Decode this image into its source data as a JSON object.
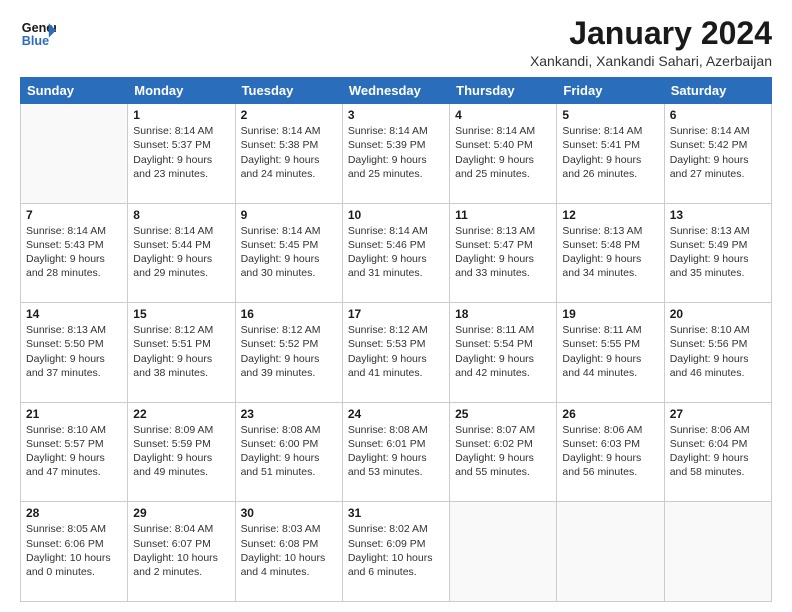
{
  "logo": {
    "line1": "General",
    "line2": "Blue"
  },
  "title": "January 2024",
  "subtitle": "Xankandi, Xankandi Sahari, Azerbaijan",
  "days_of_week": [
    "Sunday",
    "Monday",
    "Tuesday",
    "Wednesday",
    "Thursday",
    "Friday",
    "Saturday"
  ],
  "weeks": [
    [
      {
        "num": "",
        "sunrise": "",
        "sunset": "",
        "daylight": ""
      },
      {
        "num": "1",
        "sunrise": "Sunrise: 8:14 AM",
        "sunset": "Sunset: 5:37 PM",
        "daylight": "Daylight: 9 hours and 23 minutes."
      },
      {
        "num": "2",
        "sunrise": "Sunrise: 8:14 AM",
        "sunset": "Sunset: 5:38 PM",
        "daylight": "Daylight: 9 hours and 24 minutes."
      },
      {
        "num": "3",
        "sunrise": "Sunrise: 8:14 AM",
        "sunset": "Sunset: 5:39 PM",
        "daylight": "Daylight: 9 hours and 25 minutes."
      },
      {
        "num": "4",
        "sunrise": "Sunrise: 8:14 AM",
        "sunset": "Sunset: 5:40 PM",
        "daylight": "Daylight: 9 hours and 25 minutes."
      },
      {
        "num": "5",
        "sunrise": "Sunrise: 8:14 AM",
        "sunset": "Sunset: 5:41 PM",
        "daylight": "Daylight: 9 hours and 26 minutes."
      },
      {
        "num": "6",
        "sunrise": "Sunrise: 8:14 AM",
        "sunset": "Sunset: 5:42 PM",
        "daylight": "Daylight: 9 hours and 27 minutes."
      }
    ],
    [
      {
        "num": "7",
        "sunrise": "Sunrise: 8:14 AM",
        "sunset": "Sunset: 5:43 PM",
        "daylight": "Daylight: 9 hours and 28 minutes."
      },
      {
        "num": "8",
        "sunrise": "Sunrise: 8:14 AM",
        "sunset": "Sunset: 5:44 PM",
        "daylight": "Daylight: 9 hours and 29 minutes."
      },
      {
        "num": "9",
        "sunrise": "Sunrise: 8:14 AM",
        "sunset": "Sunset: 5:45 PM",
        "daylight": "Daylight: 9 hours and 30 minutes."
      },
      {
        "num": "10",
        "sunrise": "Sunrise: 8:14 AM",
        "sunset": "Sunset: 5:46 PM",
        "daylight": "Daylight: 9 hours and 31 minutes."
      },
      {
        "num": "11",
        "sunrise": "Sunrise: 8:13 AM",
        "sunset": "Sunset: 5:47 PM",
        "daylight": "Daylight: 9 hours and 33 minutes."
      },
      {
        "num": "12",
        "sunrise": "Sunrise: 8:13 AM",
        "sunset": "Sunset: 5:48 PM",
        "daylight": "Daylight: 9 hours and 34 minutes."
      },
      {
        "num": "13",
        "sunrise": "Sunrise: 8:13 AM",
        "sunset": "Sunset: 5:49 PM",
        "daylight": "Daylight: 9 hours and 35 minutes."
      }
    ],
    [
      {
        "num": "14",
        "sunrise": "Sunrise: 8:13 AM",
        "sunset": "Sunset: 5:50 PM",
        "daylight": "Daylight: 9 hours and 37 minutes."
      },
      {
        "num": "15",
        "sunrise": "Sunrise: 8:12 AM",
        "sunset": "Sunset: 5:51 PM",
        "daylight": "Daylight: 9 hours and 38 minutes."
      },
      {
        "num": "16",
        "sunrise": "Sunrise: 8:12 AM",
        "sunset": "Sunset: 5:52 PM",
        "daylight": "Daylight: 9 hours and 39 minutes."
      },
      {
        "num": "17",
        "sunrise": "Sunrise: 8:12 AM",
        "sunset": "Sunset: 5:53 PM",
        "daylight": "Daylight: 9 hours and 41 minutes."
      },
      {
        "num": "18",
        "sunrise": "Sunrise: 8:11 AM",
        "sunset": "Sunset: 5:54 PM",
        "daylight": "Daylight: 9 hours and 42 minutes."
      },
      {
        "num": "19",
        "sunrise": "Sunrise: 8:11 AM",
        "sunset": "Sunset: 5:55 PM",
        "daylight": "Daylight: 9 hours and 44 minutes."
      },
      {
        "num": "20",
        "sunrise": "Sunrise: 8:10 AM",
        "sunset": "Sunset: 5:56 PM",
        "daylight": "Daylight: 9 hours and 46 minutes."
      }
    ],
    [
      {
        "num": "21",
        "sunrise": "Sunrise: 8:10 AM",
        "sunset": "Sunset: 5:57 PM",
        "daylight": "Daylight: 9 hours and 47 minutes."
      },
      {
        "num": "22",
        "sunrise": "Sunrise: 8:09 AM",
        "sunset": "Sunset: 5:59 PM",
        "daylight": "Daylight: 9 hours and 49 minutes."
      },
      {
        "num": "23",
        "sunrise": "Sunrise: 8:08 AM",
        "sunset": "Sunset: 6:00 PM",
        "daylight": "Daylight: 9 hours and 51 minutes."
      },
      {
        "num": "24",
        "sunrise": "Sunrise: 8:08 AM",
        "sunset": "Sunset: 6:01 PM",
        "daylight": "Daylight: 9 hours and 53 minutes."
      },
      {
        "num": "25",
        "sunrise": "Sunrise: 8:07 AM",
        "sunset": "Sunset: 6:02 PM",
        "daylight": "Daylight: 9 hours and 55 minutes."
      },
      {
        "num": "26",
        "sunrise": "Sunrise: 8:06 AM",
        "sunset": "Sunset: 6:03 PM",
        "daylight": "Daylight: 9 hours and 56 minutes."
      },
      {
        "num": "27",
        "sunrise": "Sunrise: 8:06 AM",
        "sunset": "Sunset: 6:04 PM",
        "daylight": "Daylight: 9 hours and 58 minutes."
      }
    ],
    [
      {
        "num": "28",
        "sunrise": "Sunrise: 8:05 AM",
        "sunset": "Sunset: 6:06 PM",
        "daylight": "Daylight: 10 hours and 0 minutes."
      },
      {
        "num": "29",
        "sunrise": "Sunrise: 8:04 AM",
        "sunset": "Sunset: 6:07 PM",
        "daylight": "Daylight: 10 hours and 2 minutes."
      },
      {
        "num": "30",
        "sunrise": "Sunrise: 8:03 AM",
        "sunset": "Sunset: 6:08 PM",
        "daylight": "Daylight: 10 hours and 4 minutes."
      },
      {
        "num": "31",
        "sunrise": "Sunrise: 8:02 AM",
        "sunset": "Sunset: 6:09 PM",
        "daylight": "Daylight: 10 hours and 6 minutes."
      },
      {
        "num": "",
        "sunrise": "",
        "sunset": "",
        "daylight": ""
      },
      {
        "num": "",
        "sunrise": "",
        "sunset": "",
        "daylight": ""
      },
      {
        "num": "",
        "sunrise": "",
        "sunset": "",
        "daylight": ""
      }
    ]
  ]
}
